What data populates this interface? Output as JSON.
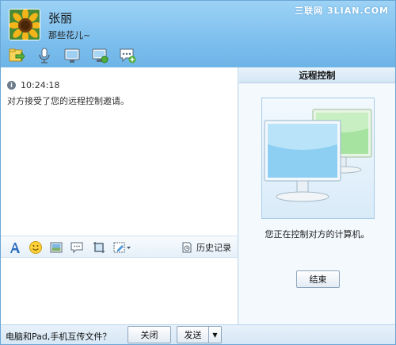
{
  "window": {
    "watermark": "三联网 3LIAN.COM"
  },
  "contact": {
    "name": "张丽",
    "status": "那些花儿~"
  },
  "toolbar_top": {
    "items": [
      "transfer-file-icon",
      "voice-call-icon",
      "video-call-icon",
      "remote-assist-icon",
      "app-add-icon"
    ]
  },
  "chat": {
    "messages": [
      {
        "time": "10:24:18",
        "text": "对方接受了您的远程控制邀请。"
      }
    ]
  },
  "input_toolbar": {
    "items": [
      "font-icon",
      "emoji-icon",
      "image-icon",
      "message-icon",
      "screenshot-icon",
      "paint-icon"
    ],
    "history_label": "历史记录"
  },
  "remote_panel": {
    "title": "远程控制",
    "status": "您正在控制对方的计算机。",
    "end_button": "结束"
  },
  "footer": {
    "share_text": "电脑和Pad,手机互传文件？",
    "close_button": "关闭",
    "send_button": "发送",
    "send_dropdown": "▼"
  },
  "colors": {
    "header": "#7dbfee",
    "panel_border": "#b9d3ea",
    "monitor_front": "#9fd4f7",
    "monitor_back": "#9fe09a"
  }
}
